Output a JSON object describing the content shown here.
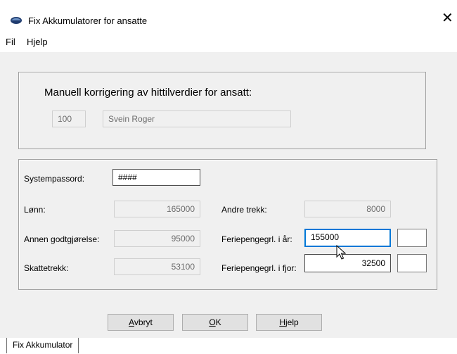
{
  "window": {
    "title": "Fix Akkumulatorer for ansatte"
  },
  "menu": {
    "file": "Fil",
    "help": "Hjelp"
  },
  "header": {
    "heading": "Manuell korrigering av hittilverdier for ansatt:",
    "employee_number": "100",
    "employee_name": "Svein Roger"
  },
  "form": {
    "system_password_label": "Systempassord:",
    "system_password_value": "####",
    "salary_label": "Lønn:",
    "salary_value": "165000",
    "other_comp_label": "Annen godtgjørelse:",
    "other_comp_value": "95000",
    "tax_label": "Skattetrekk:",
    "tax_value": "53100",
    "other_ded_label": "Andre trekk:",
    "other_ded_value": "8000",
    "holiday_this_year_label": "Feriepengegrl. i år:",
    "holiday_this_year_value": "155000",
    "holiday_last_year_label": "Feriepengegrl. i fjor:",
    "holiday_last_year_value": "32500"
  },
  "buttons": {
    "cancel_prefix": "",
    "cancel_key": "A",
    "cancel_rest": "vbryt",
    "ok_key": "O",
    "ok_rest": "K",
    "help_key": "H",
    "help_rest": "jelp"
  },
  "tabs": {
    "active": "Fix Akkumulator"
  },
  "icons": {
    "app": "app-logo-icon",
    "close": "close-icon",
    "cursor": "mouse-pointer-icon"
  }
}
